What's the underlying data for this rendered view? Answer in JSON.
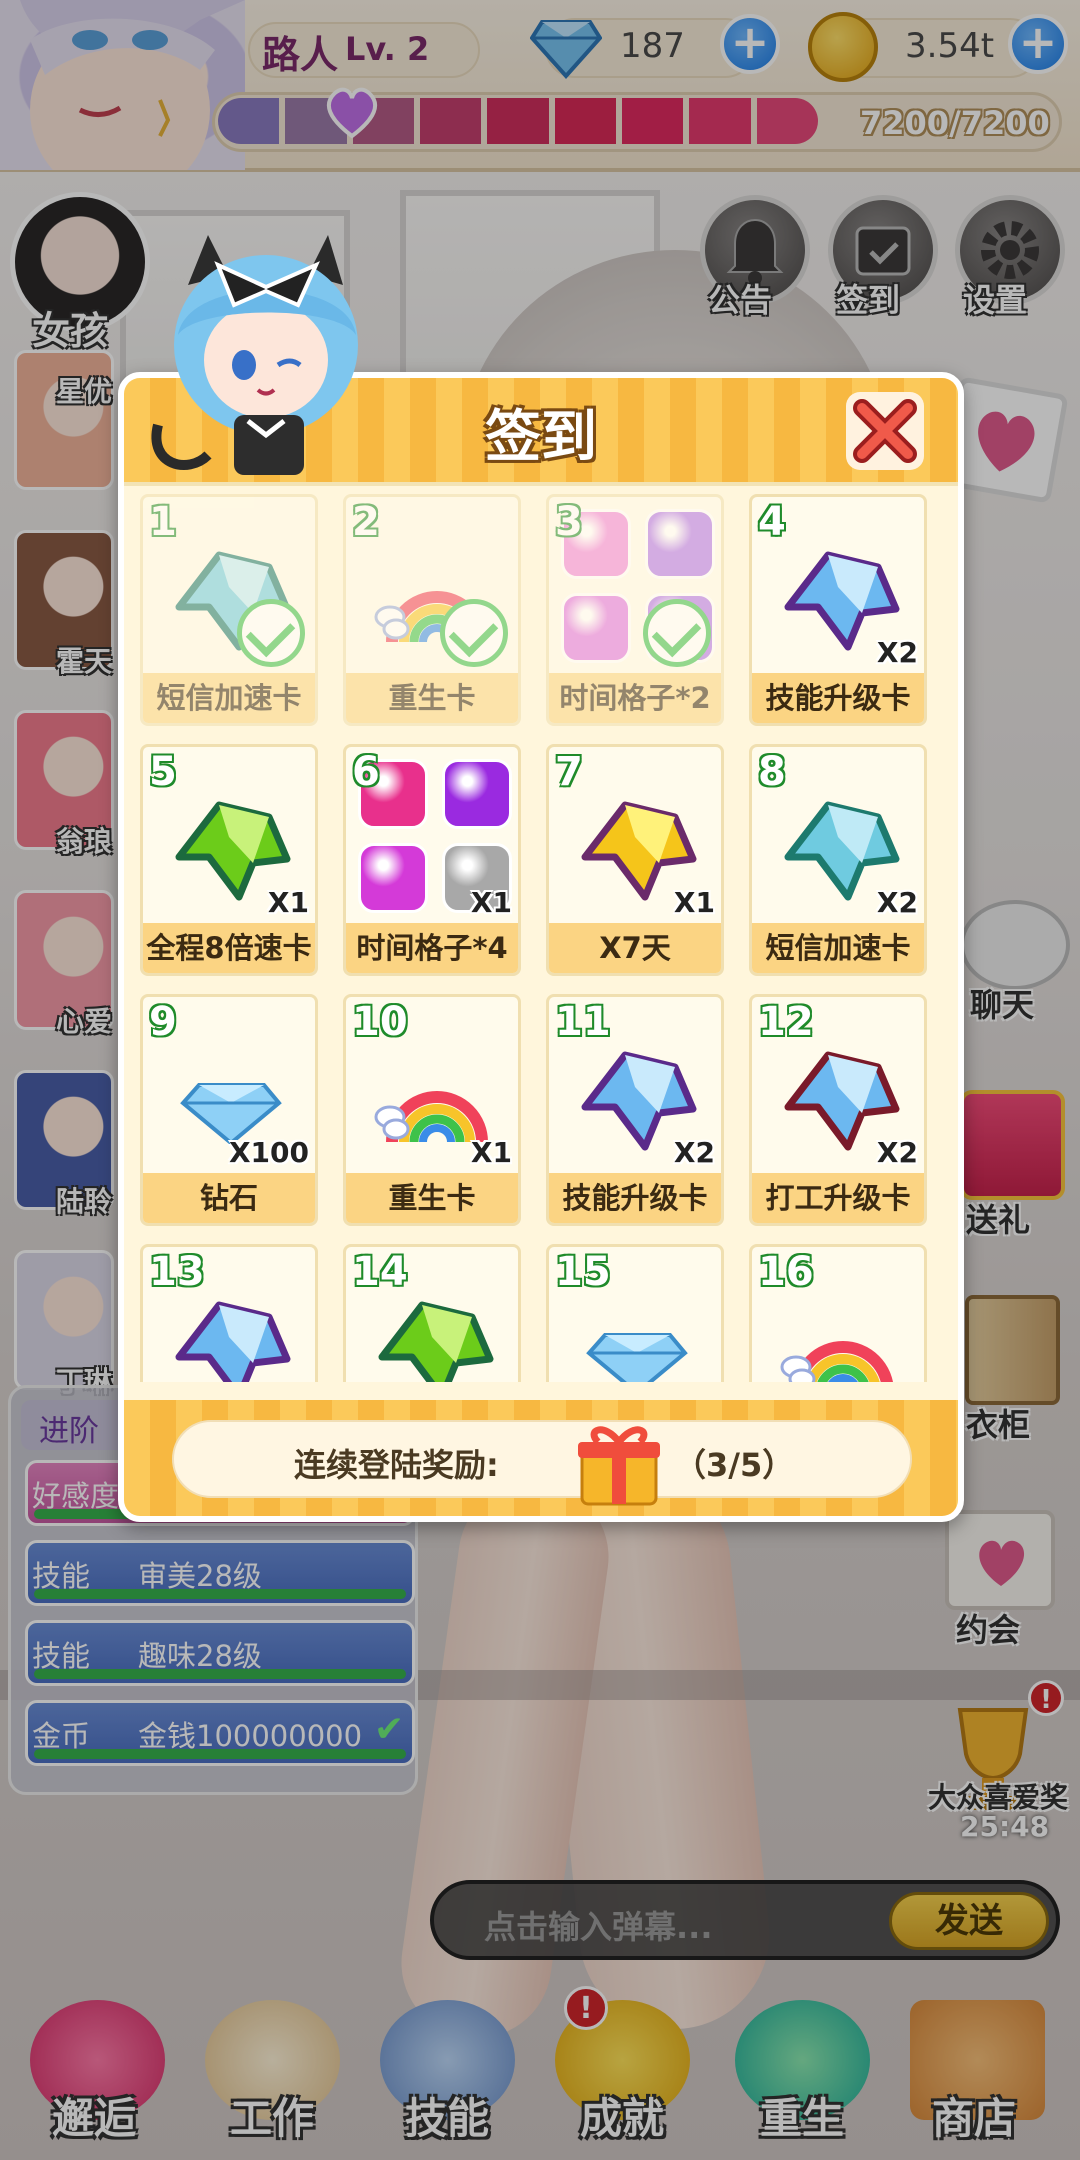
{
  "header": {
    "player_name": "路人",
    "player_level": "Lv. 2",
    "diamonds": "187",
    "coins": "3.54t",
    "stamina": "7200/7200",
    "colors": {
      "diamond": "#5aa9e8",
      "coin": "#f5b91e",
      "plus": "#1e7ee8",
      "stamina_seg": [
        "#8a7bbf",
        "#9a7aa8",
        "#b35a86",
        "#c43f6e",
        "#cf2f5e",
        "#d82a58",
        "#e02a60",
        "#e33a6e",
        "#e6487a"
      ]
    }
  },
  "left_panel": {
    "girls_button": "女孩",
    "girls": [
      "星优",
      "霍天",
      "翁琅",
      "心爱",
      "陆聆",
      "丁琳"
    ],
    "tasks": [
      {
        "cat": "进阶",
        "name": ""
      },
      {
        "cat": "好感度",
        "name": ""
      },
      {
        "cat": "技能",
        "name": "审美28级"
      },
      {
        "cat": "技能",
        "name": "趣味28级"
      },
      {
        "cat": "金币",
        "name": "金钱100000000",
        "done": true
      }
    ]
  },
  "top_right": {
    "notice": "公告",
    "checkin": "签到",
    "settings": "设置"
  },
  "right_side": {
    "chat": "聊天",
    "gift": "送礼",
    "wardrobe": "衣柜",
    "date": "约会",
    "award": "大众喜爱奖",
    "award_timer": "25:48"
  },
  "chat_bar": {
    "placeholder": "点击输入弹幕...",
    "send": "发送"
  },
  "bottom_nav": [
    "邂逅",
    "工作",
    "技能",
    "成就",
    "重生",
    "商店"
  ],
  "modal": {
    "title": "签到",
    "streak_label": "连续登陆奖励:",
    "streak_value": "（3/5）",
    "cells": [
      {
        "day": "1",
        "label": "短信加速卡",
        "count": "",
        "icon": "gem-teal",
        "claimed": true
      },
      {
        "day": "2",
        "label": "重生卡",
        "count": "",
        "icon": "rainbow",
        "claimed": true
      },
      {
        "day": "3",
        "label": "时间格子*2",
        "count": "",
        "icon": "boxes-pink-purple",
        "claimed": true
      },
      {
        "day": "4",
        "label": "技能升级卡",
        "count": "X2",
        "icon": "gem-purple",
        "claimed": false
      },
      {
        "day": "5",
        "label": "全程8倍速卡",
        "count": "X1",
        "icon": "gem-green",
        "claimed": false
      },
      {
        "day": "6",
        "label": "时间格子*4",
        "count": "X1",
        "icon": "boxes-mixed",
        "claimed": false
      },
      {
        "day": "7",
        "label": "X7天",
        "count": "X1",
        "icon": "gem-yellow",
        "claimed": false
      },
      {
        "day": "8",
        "label": "短信加速卡",
        "count": "X2",
        "icon": "gem-teal",
        "claimed": false
      },
      {
        "day": "9",
        "label": "钻石",
        "count": "X100",
        "icon": "diamond",
        "claimed": false
      },
      {
        "day": "10",
        "label": "重生卡",
        "count": "X1",
        "icon": "rainbow",
        "claimed": false
      },
      {
        "day": "11",
        "label": "技能升级卡",
        "count": "X2",
        "icon": "gem-purple",
        "claimed": false
      },
      {
        "day": "12",
        "label": "打工升级卡",
        "count": "X2",
        "icon": "gem-red",
        "claimed": false
      },
      {
        "day": "13",
        "label": "",
        "count": "",
        "icon": "gem-purple",
        "claimed": false
      },
      {
        "day": "14",
        "label": "",
        "count": "",
        "icon": "gem-green",
        "claimed": false
      },
      {
        "day": "15",
        "label": "",
        "count": "",
        "icon": "diamond",
        "claimed": false
      },
      {
        "day": "16",
        "label": "",
        "count": "",
        "icon": "rainbow",
        "claimed": false
      }
    ]
  }
}
